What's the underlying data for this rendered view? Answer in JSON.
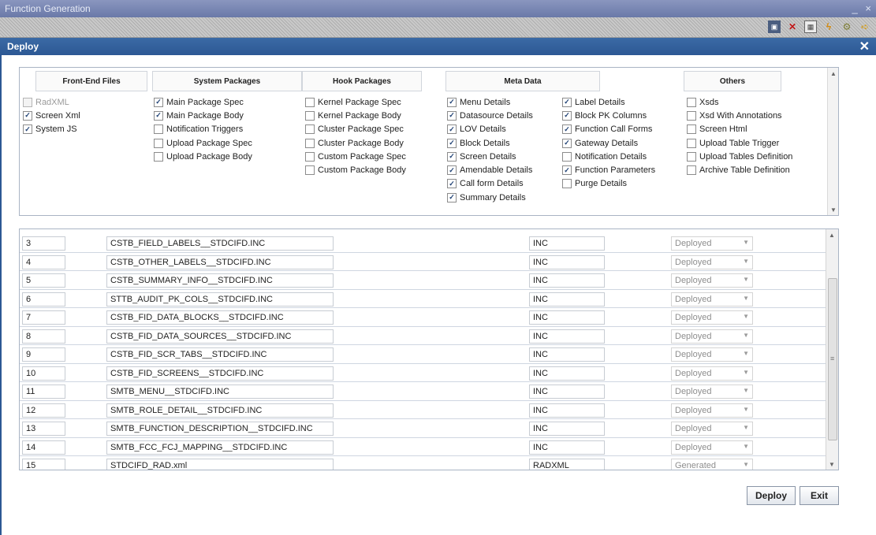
{
  "window": {
    "title": "Function Generation",
    "minimize": "_",
    "close": "×"
  },
  "toolbar": {
    "icons": [
      {
        "name": "save-icon",
        "glyph": "▣"
      },
      {
        "name": "delete-icon",
        "glyph": "✕"
      },
      {
        "name": "grid-icon",
        "glyph": "▦"
      },
      {
        "name": "generate-icon",
        "glyph": "ϟ"
      },
      {
        "name": "settings-icon",
        "glyph": "⚙"
      },
      {
        "name": "forward-icon",
        "glyph": "➪"
      }
    ]
  },
  "dialog": {
    "title": "Deploy",
    "close": "✕"
  },
  "categories": [
    {
      "label": "Front-End Files"
    },
    {
      "label": "System Packages"
    },
    {
      "label": "Hook Packages"
    },
    {
      "label": "Meta Data"
    },
    {
      "label": "Others"
    }
  ],
  "option_columns": [
    {
      "group": "Front-End Files",
      "items": [
        {
          "label": "RadXML",
          "checked": false,
          "disabled": true
        },
        {
          "label": "Screen Xml",
          "checked": true
        },
        {
          "label": "System JS",
          "checked": true
        }
      ]
    },
    {
      "group": "System Packages",
      "items": [
        {
          "label": "Main Package Spec",
          "checked": true
        },
        {
          "label": "Main Package Body",
          "checked": true
        },
        {
          "label": "Notification Triggers",
          "checked": false
        },
        {
          "label": "Upload Package Spec",
          "checked": false
        },
        {
          "label": "Upload Package Body",
          "checked": false
        }
      ]
    },
    {
      "group": "Hook Packages",
      "items": [
        {
          "label": "Kernel Package Spec",
          "checked": false
        },
        {
          "label": "Kernel Package Body",
          "checked": false
        },
        {
          "label": "Cluster Package Spec",
          "checked": false
        },
        {
          "label": "Cluster Package Body",
          "checked": false
        },
        {
          "label": "Custom Package Spec",
          "checked": false
        },
        {
          "label": "Custom Package Body",
          "checked": false
        }
      ]
    },
    {
      "group": "Meta Data",
      "items": [
        {
          "label": "Menu Details",
          "checked": true
        },
        {
          "label": "Datasource Details",
          "checked": true
        },
        {
          "label": "LOV Details",
          "checked": true
        },
        {
          "label": "Block Details",
          "checked": true
        },
        {
          "label": "Screen Details",
          "checked": true
        },
        {
          "label": "Amendable Details",
          "checked": true
        },
        {
          "label": "Call form Details",
          "checked": true
        },
        {
          "label": "Summary Details",
          "checked": true
        }
      ]
    },
    {
      "group": "Meta Data",
      "items": [
        {
          "label": "Label Details",
          "checked": true
        },
        {
          "label": "Block PK Columns",
          "checked": true
        },
        {
          "label": "Function Call Forms",
          "checked": true
        },
        {
          "label": "Gateway Details",
          "checked": true
        },
        {
          "label": "Notification Details",
          "checked": false
        },
        {
          "label": "Function Parameters",
          "checked": true
        },
        {
          "label": "Purge Details",
          "checked": false
        }
      ]
    },
    {
      "group": "Others",
      "items": [
        {
          "label": "Xsds",
          "checked": false
        },
        {
          "label": "Xsd With Annotations",
          "checked": false
        },
        {
          "label": "Screen Html",
          "checked": false
        },
        {
          "label": "Upload Table Trigger",
          "checked": false
        },
        {
          "label": "Upload Tables Definition",
          "checked": false
        },
        {
          "label": "Archive Table Definition",
          "checked": false
        }
      ]
    }
  ],
  "files": [
    {
      "no": "3",
      "name": "CSTB_FIELD_LABELS__STDCIFD.INC",
      "type": "INC",
      "status": "Deployed"
    },
    {
      "no": "4",
      "name": "CSTB_OTHER_LABELS__STDCIFD.INC",
      "type": "INC",
      "status": "Deployed"
    },
    {
      "no": "5",
      "name": "CSTB_SUMMARY_INFO__STDCIFD.INC",
      "type": "INC",
      "status": "Deployed"
    },
    {
      "no": "6",
      "name": "STTB_AUDIT_PK_COLS__STDCIFD.INC",
      "type": "INC",
      "status": "Deployed"
    },
    {
      "no": "7",
      "name": "CSTB_FID_DATA_BLOCKS__STDCIFD.INC",
      "type": "INC",
      "status": "Deployed"
    },
    {
      "no": "8",
      "name": "CSTB_FID_DATA_SOURCES__STDCIFD.INC",
      "type": "INC",
      "status": "Deployed"
    },
    {
      "no": "9",
      "name": "CSTB_FID_SCR_TABS__STDCIFD.INC",
      "type": "INC",
      "status": "Deployed"
    },
    {
      "no": "10",
      "name": "CSTB_FID_SCREENS__STDCIFD.INC",
      "type": "INC",
      "status": "Deployed"
    },
    {
      "no": "11",
      "name": "SMTB_MENU__STDCIFD.INC",
      "type": "INC",
      "status": "Deployed"
    },
    {
      "no": "12",
      "name": "SMTB_ROLE_DETAIL__STDCIFD.INC",
      "type": "INC",
      "status": "Deployed"
    },
    {
      "no": "13",
      "name": "SMTB_FUNCTION_DESCRIPTION__STDCIFD.INC",
      "type": "INC",
      "status": "Deployed"
    },
    {
      "no": "14",
      "name": "SMTB_FCC_FCJ_MAPPING__STDCIFD.INC",
      "type": "INC",
      "status": "Deployed"
    },
    {
      "no": "15",
      "name": "STDCIFD_RAD.xml",
      "type": "RADXML",
      "status": "Generated"
    }
  ],
  "buttons": {
    "deploy": "Deploy",
    "exit": "Exit"
  }
}
